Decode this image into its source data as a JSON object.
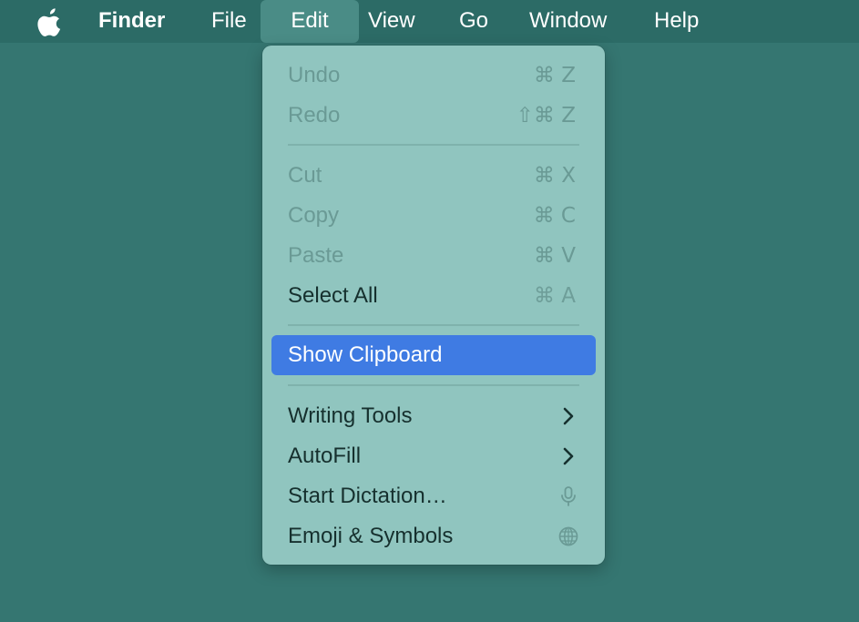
{
  "menubar": {
    "app_name": "Finder",
    "items": [
      "File",
      "Edit",
      "View",
      "Go",
      "Window",
      "Help"
    ],
    "active_item": "Edit"
  },
  "edit_menu": {
    "undo": {
      "label": "Undo",
      "shortcut": "⌘ Z"
    },
    "redo": {
      "label": "Redo",
      "shortcut": "⇧⌘ Z"
    },
    "cut": {
      "label": "Cut",
      "shortcut": "⌘ X"
    },
    "copy": {
      "label": "Copy",
      "shortcut": "⌘ C"
    },
    "paste": {
      "label": "Paste",
      "shortcut": "⌘ V"
    },
    "select_all": {
      "label": "Select All",
      "shortcut": "⌘ A"
    },
    "show_clipboard": {
      "label": "Show Clipboard"
    },
    "writing_tools": {
      "label": "Writing Tools",
      "icon": "chevron-right-icon"
    },
    "autofill": {
      "label": "AutoFill",
      "icon": "chevron-right-icon"
    },
    "start_dictation": {
      "label": "Start Dictation…",
      "icon": "microphone-icon"
    },
    "emoji_symbols": {
      "label": "Emoji & Symbols",
      "icon": "globe-icon"
    }
  },
  "colors": {
    "desktop": "#357671",
    "menubar": "#2c6b66",
    "menu_background": "#90c5bf",
    "highlight": "#3f7be3"
  }
}
